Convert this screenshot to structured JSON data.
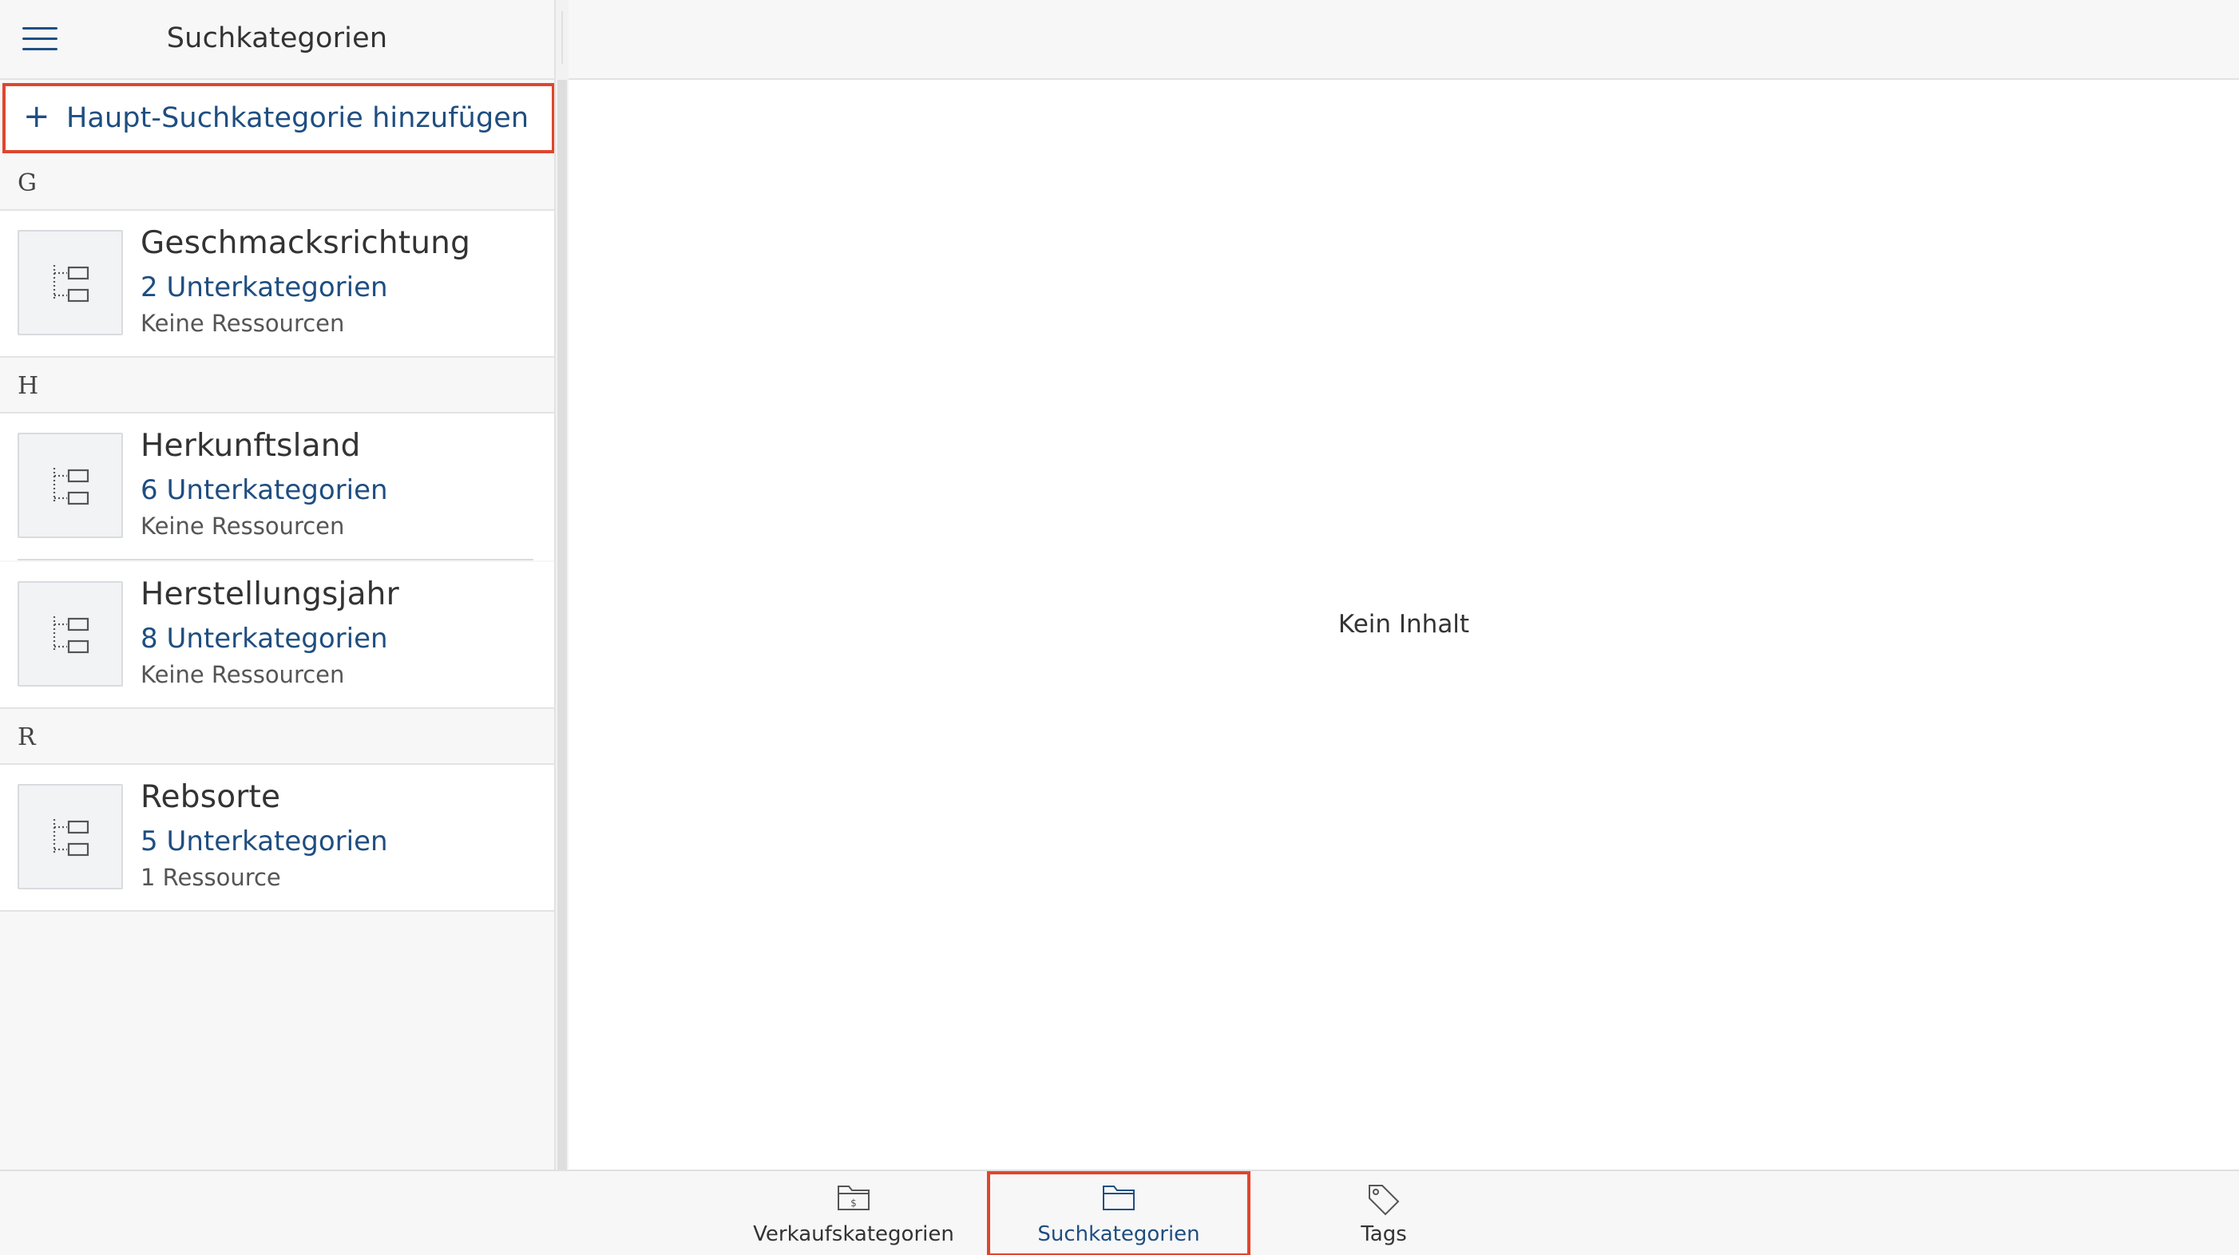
{
  "sidebar": {
    "title": "Suchkategorien",
    "menu_icon": "hamburger-menu-icon",
    "add_button": {
      "icon": "plus-icon",
      "label": "Haupt-Suchkategorie hinzufügen"
    },
    "sections": [
      {
        "letter": "G"
      },
      {
        "letter": "H"
      },
      {
        "letter": "R"
      }
    ],
    "categories": [
      {
        "name": "Geschmacksrichtung",
        "subcategories": "2 Unterkategorien",
        "resources": "Keine Ressourcen",
        "icon": "hierarchy-icon"
      },
      {
        "name": "Herkunftsland",
        "subcategories": "6 Unterkategorien",
        "resources": "Keine Ressourcen",
        "icon": "hierarchy-icon"
      },
      {
        "name": "Herstellungsjahr",
        "subcategories": "8 Unterkategorien",
        "resources": "Keine Ressourcen",
        "icon": "hierarchy-icon"
      },
      {
        "name": "Rebsorte",
        "subcategories": "5 Unterkategorien",
        "resources": "1 Ressource",
        "icon": "hierarchy-icon"
      }
    ]
  },
  "main": {
    "empty_message": "Kein Inhalt"
  },
  "tabbar": {
    "tabs": [
      {
        "label": "Verkaufskategorien",
        "icon": "folder-dollar-icon",
        "active": false
      },
      {
        "label": "Suchkategorien",
        "icon": "folder-icon",
        "active": true
      },
      {
        "label": "Tags",
        "icon": "tag-icon",
        "active": false
      }
    ]
  },
  "colors": {
    "accent": "#1f4e80",
    "highlight_border": "#e0452d",
    "sidebar_bg": "#f7f7f8",
    "thumb_bg": "#f2f3f5"
  }
}
